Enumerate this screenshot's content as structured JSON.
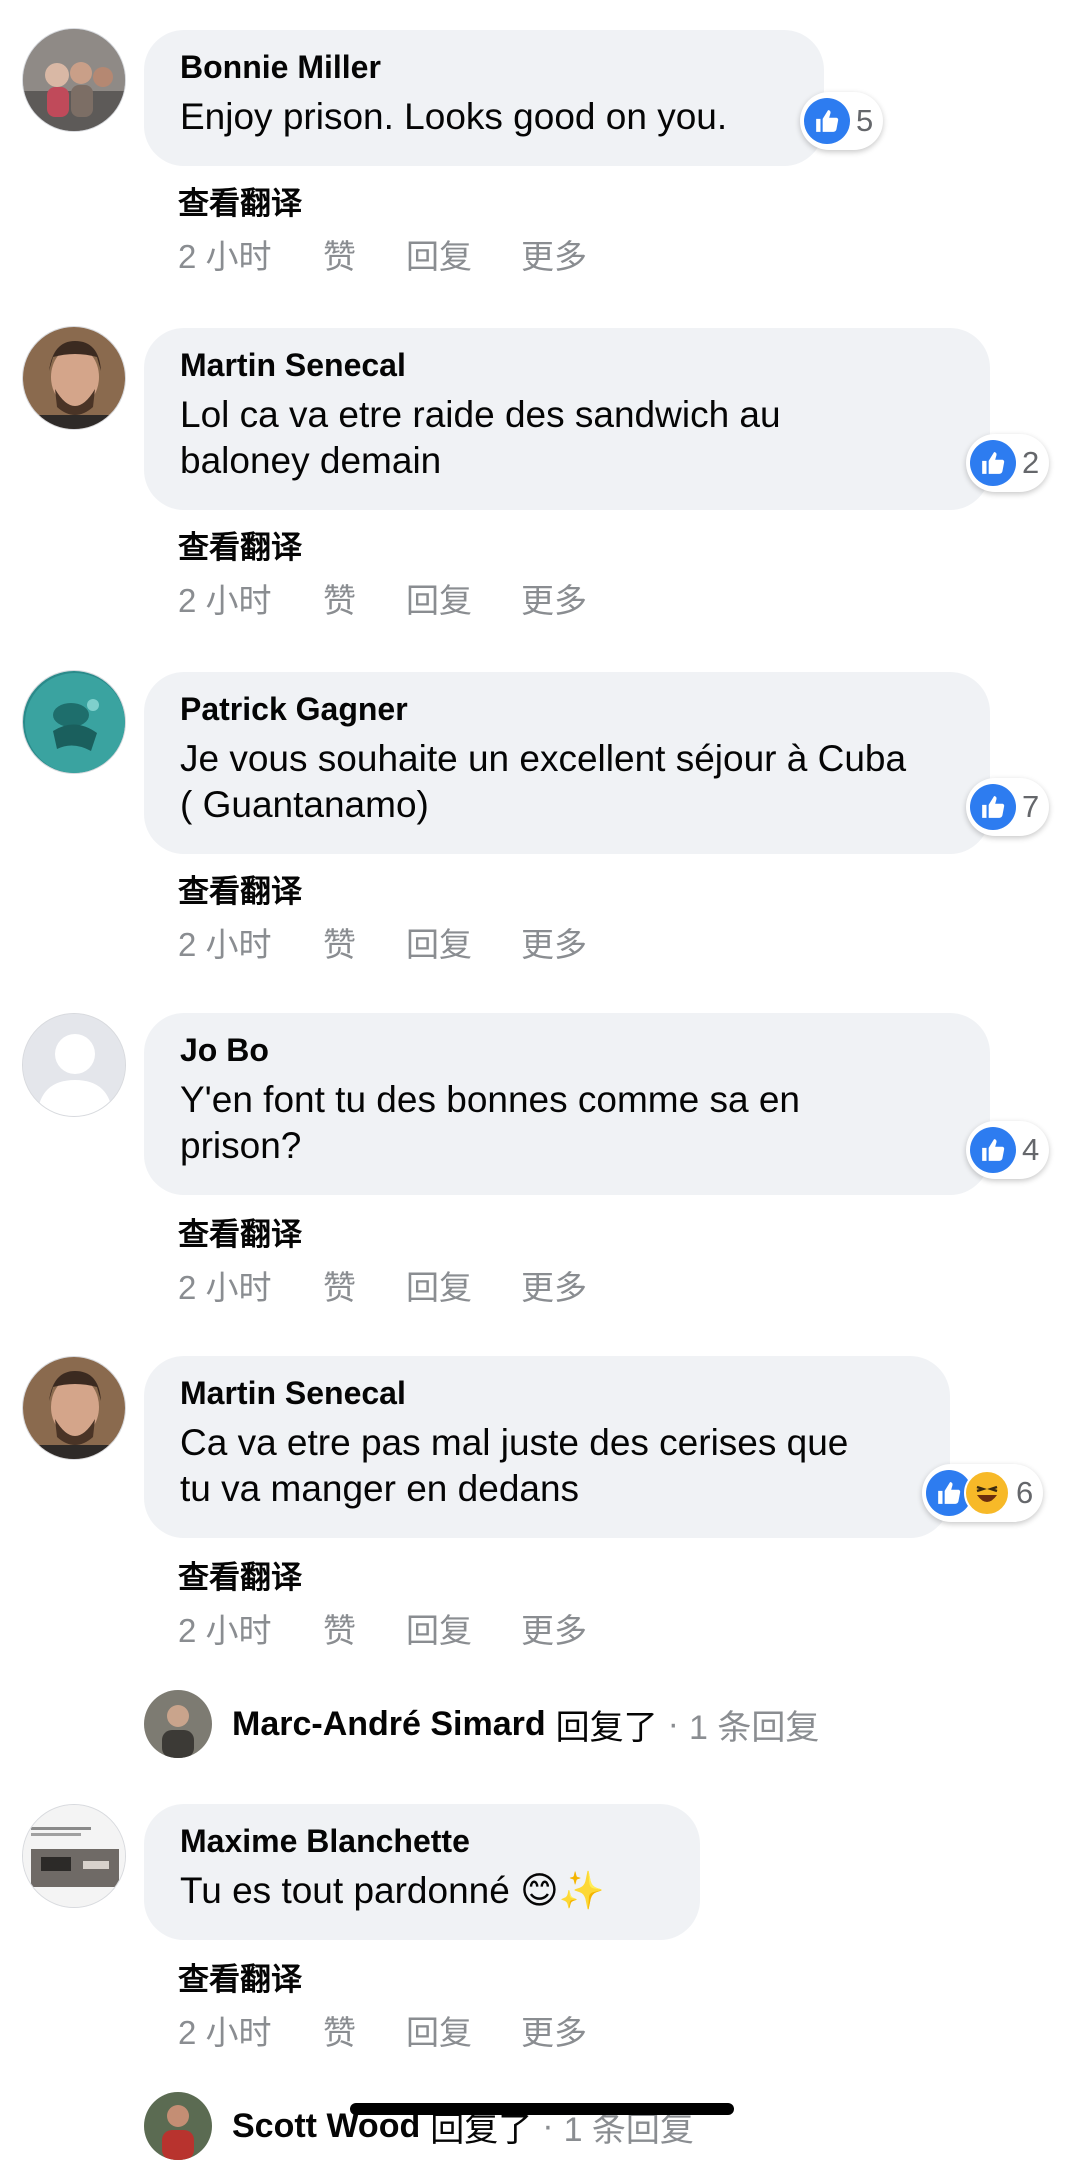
{
  "labels": {
    "see_translation": "查看翻译",
    "time": "2 小时",
    "like": "赞",
    "reply": "回复",
    "more": "更多"
  },
  "comments": [
    {
      "author": "Bonnie Miller",
      "text": "Enjoy prison. Looks good on you.",
      "reactions": [
        "like"
      ],
      "reaction_count": "5"
    },
    {
      "author": "Martin Senecal",
      "text": "Lol ca va etre raide des sandwich au baloney demain",
      "reactions": [
        "like"
      ],
      "reaction_count": "2"
    },
    {
      "author": "Patrick Gagner",
      "text": "Je vous souhaite un excellent séjour à Cuba ( Guantanamo)",
      "reactions": [
        "like"
      ],
      "reaction_count": "7"
    },
    {
      "author": "Jo Bo",
      "text": "Y'en font tu des bonnes comme sa en prison?",
      "reactions": [
        "like"
      ],
      "reaction_count": "4"
    },
    {
      "author": "Martin Senecal",
      "text": "Ca va etre pas mal juste des cerises que tu va manger en dedans",
      "reactions": [
        "like",
        "haha"
      ],
      "reaction_count": "6"
    },
    {
      "author": "Maxime Blanchette",
      "text": "Tu es tout pardonné 😊✨"
    }
  ],
  "replies": [
    {
      "author": "Marc-André Simard",
      "verb": "回复了",
      "dot": "·",
      "count": "1 条回复"
    },
    {
      "author": "Scott Wood",
      "verb": "回复了",
      "dot": "·",
      "count": "1 条回复"
    }
  ],
  "colors": {
    "like_blue": "#2d7cf0",
    "haha_yellow": "#f7b928",
    "bubble_gray": "#f0f2f5",
    "meta_gray": "#8a8d91"
  }
}
